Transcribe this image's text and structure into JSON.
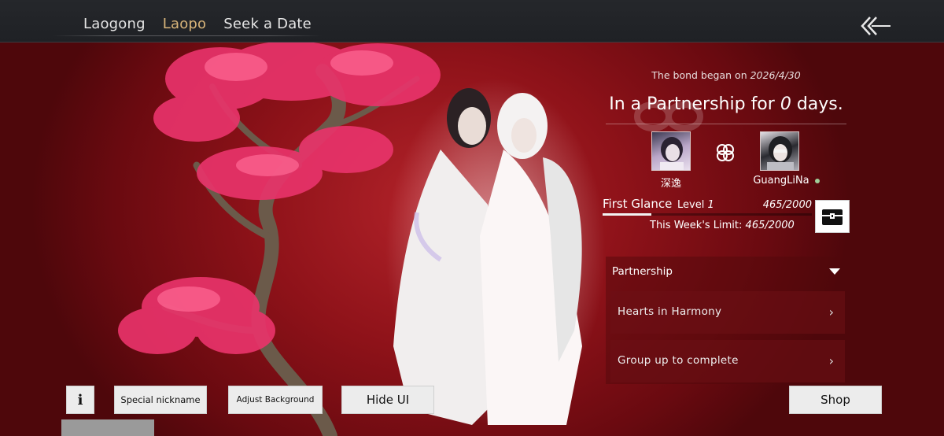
{
  "nav": {
    "tabs": [
      {
        "label": "Laogong",
        "active": false
      },
      {
        "label": "Laopo",
        "active": true
      },
      {
        "label": "Seek a Date",
        "active": false
      }
    ],
    "back_icon": "double-chevron-back-icon"
  },
  "bond": {
    "began_prefix": "The bond began on",
    "began_date": "2026/4/30",
    "days_prefix": "In a Partnership for",
    "days_value": "0",
    "days_suffix": "days.",
    "link_icon": "knot-link-icon"
  },
  "partners": {
    "left_name": "深逸",
    "right_name": "GuangLiNa",
    "right_status": "online",
    "status_color": "#9fcf9a"
  },
  "level": {
    "name": "First Glance",
    "level_label": "Level",
    "level_value": "1",
    "progress_text": "465/2000",
    "progress_fraction": 0.2325,
    "week_limit_label": "This Week's Limit:",
    "week_limit_value": "465/2000",
    "chest_icon": "treasure-chest-icon"
  },
  "section": {
    "title": "Partnership",
    "items": [
      {
        "label": "Hearts in Harmony"
      },
      {
        "label": "Group up to complete"
      }
    ]
  },
  "bottom": {
    "info_label": "i",
    "nickname_label": "Special nickname",
    "background_label": "Adjust Background",
    "hide_ui_label": "Hide UI",
    "shop_label": "Shop"
  },
  "colors": {
    "accent_gold": "#d9b57a",
    "background_red": "#8e1219",
    "topbar": "#222428"
  }
}
